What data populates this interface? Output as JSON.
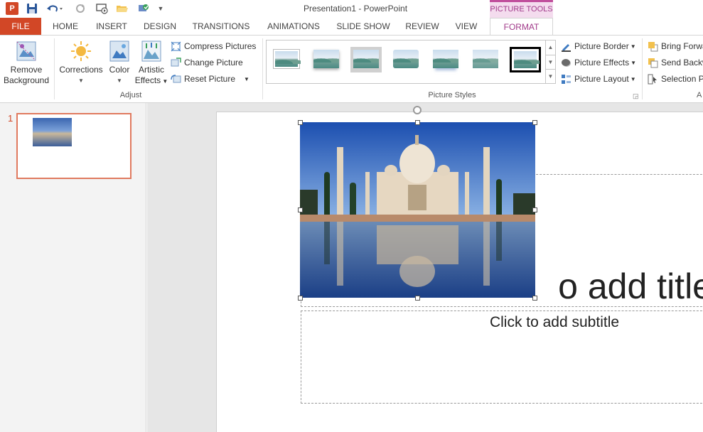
{
  "titlebar": {
    "window_title": "Presentation1 - PowerPoint",
    "contextual_tab_group": "PICTURE TOOLS",
    "app_logo": "P",
    "icons": [
      "powerpoint-logo-icon",
      "save-icon",
      "undo-icon",
      "redo-icon",
      "start-from-beginning-icon",
      "open-icon",
      "touch-mode-icon",
      "customize-qat-icon"
    ]
  },
  "tabs": [
    "FILE",
    "HOME",
    "INSERT",
    "DESIGN",
    "TRANSITIONS",
    "ANIMATIONS",
    "SLIDE SHOW",
    "REVIEW",
    "VIEW",
    "FORMAT"
  ],
  "active_tab": "FORMAT",
  "ribbon": {
    "adjust": {
      "remove_background": [
        "Remove",
        "Background"
      ],
      "corrections": "Corrections",
      "color": "Color",
      "artistic_effects": [
        "Artistic",
        "Effects"
      ],
      "compress_pictures": "Compress Pictures",
      "change_picture": "Change Picture",
      "reset_picture": "Reset Picture",
      "group_label": "Adjust"
    },
    "picture_styles": {
      "group_label": "Picture Styles",
      "picture_border": "Picture Border",
      "picture_effects": "Picture Effects",
      "picture_layout": "Picture Layout"
    },
    "arrange": {
      "bring_forward": "Bring Forwa",
      "send_backward": "Send Backw",
      "selection_pane": "Selection P",
      "group_label_partial": "A"
    }
  },
  "slides_pane": {
    "slide_number": "1"
  },
  "slide": {
    "title_placeholder": "o add title",
    "subtitle_placeholder": "Click to add subtitle"
  },
  "colors": {
    "file_tab": "#d24726",
    "picture_tools": "#c04f9c",
    "format_tab_text": "#a13a8a"
  }
}
